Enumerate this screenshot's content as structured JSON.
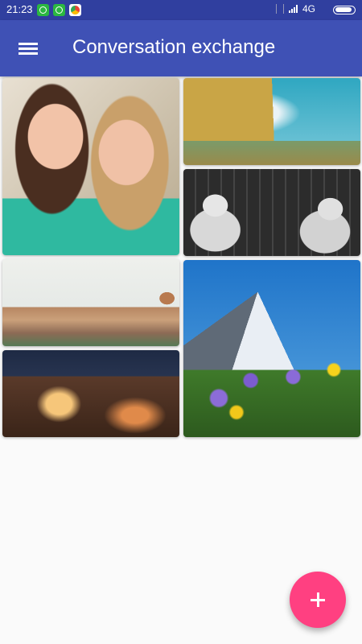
{
  "status_bar": {
    "time": "21:23",
    "network": "4G",
    "notification_icons": [
      "whatsapp-icon",
      "whatsapp-icon",
      "chrome-icon"
    ]
  },
  "app_bar": {
    "title": "Conversation exchange",
    "menu_icon": "hamburger-menu-icon",
    "color": "#3f51b5"
  },
  "gallery": {
    "images": [
      {
        "subject": "two-girls-portrait"
      },
      {
        "subject": "sandcastle"
      },
      {
        "subject": "black-and-white-girls-at-door"
      },
      {
        "subject": "florence-cityscape"
      },
      {
        "subject": "madrid-night-city"
      },
      {
        "subject": "matterhorn-mountain-flowers"
      }
    ]
  },
  "fab": {
    "icon": "plus-icon",
    "color": "#ff4081"
  }
}
